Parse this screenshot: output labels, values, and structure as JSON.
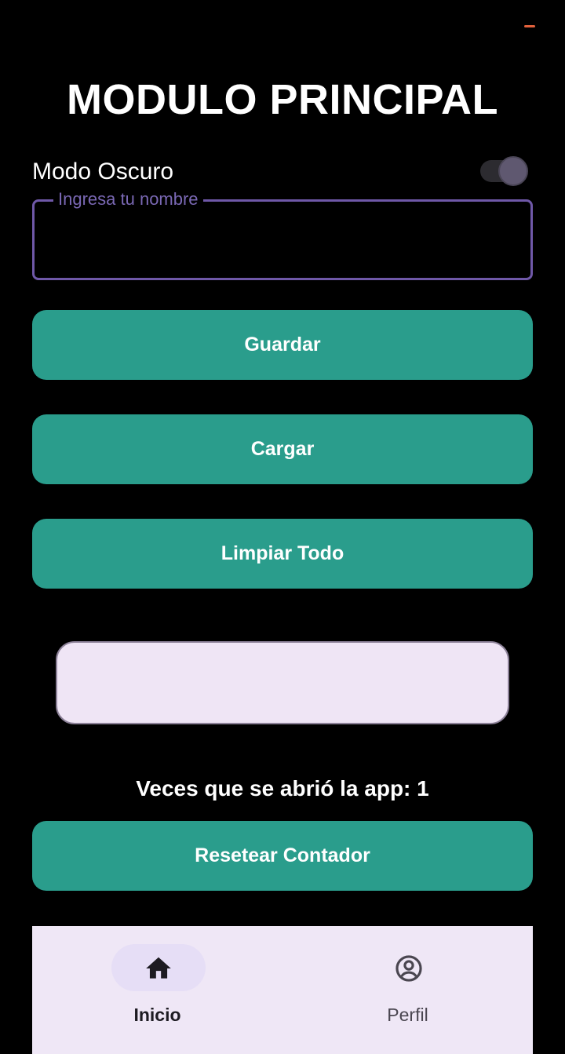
{
  "app": {
    "title": "MODULO PRINCIPAL"
  },
  "settings": {
    "dark_mode_label": "Modo Oscuro",
    "dark_mode_on": true
  },
  "name_field": {
    "label": "Ingresa tu nombre",
    "value": ""
  },
  "buttons": {
    "save": "Guardar",
    "load": "Cargar",
    "clear_all": "Limpiar Todo",
    "reset_counter": "Resetear Contador"
  },
  "result": {
    "text": ""
  },
  "counter": {
    "text": "Veces que se abrió la app: 1"
  },
  "bottom_nav": {
    "items": [
      {
        "label": "Inicio",
        "icon": "home-icon",
        "active": true
      },
      {
        "label": "Perfil",
        "icon": "account-circle-icon",
        "active": false
      }
    ]
  },
  "colors": {
    "background": "#000000",
    "primary_button": "#2a9d8c",
    "field_outline": "#6f58a8",
    "nav_background": "#efe7f6",
    "status_accent": "#e2613c"
  }
}
